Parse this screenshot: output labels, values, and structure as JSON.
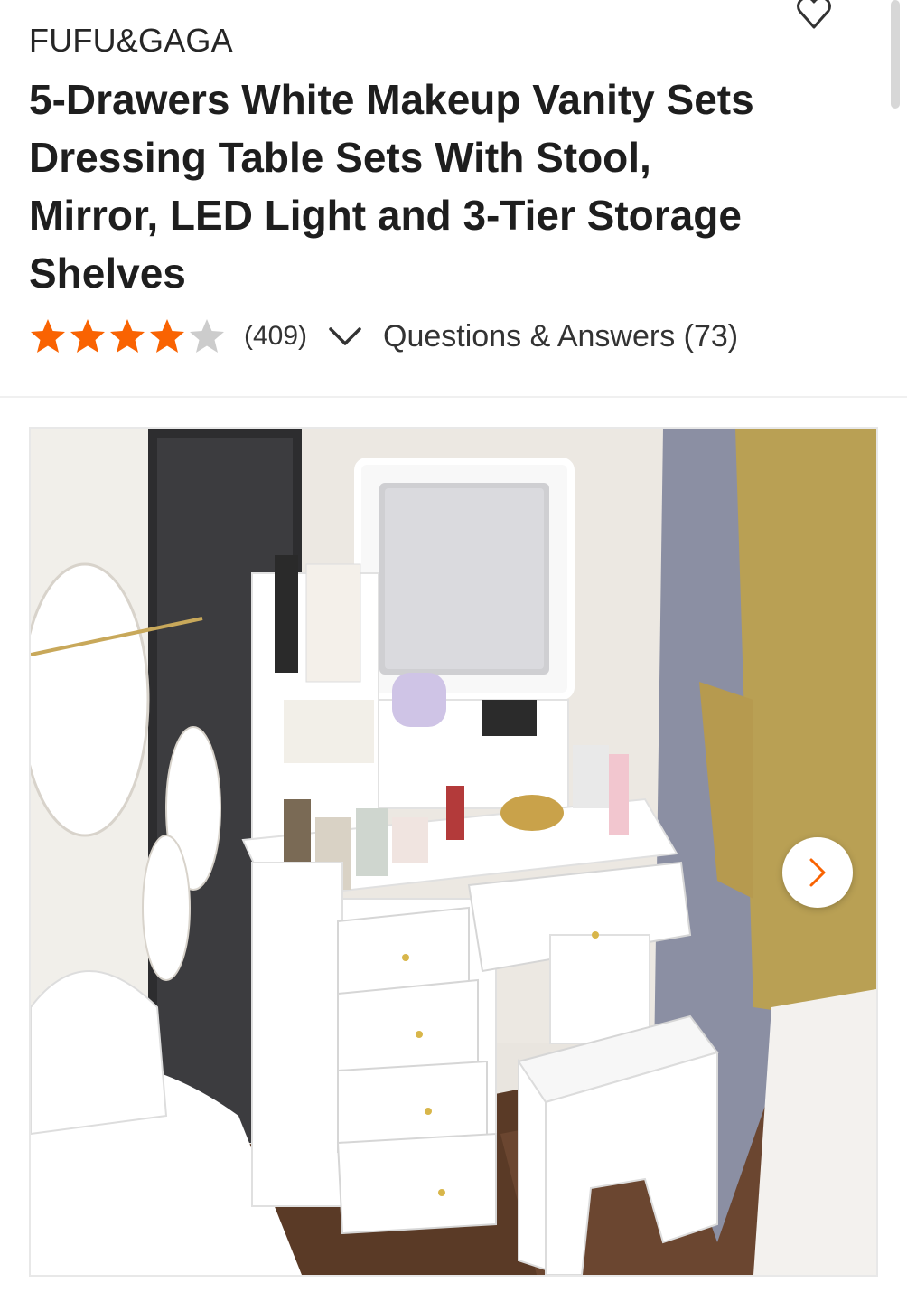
{
  "product": {
    "brand": "FUFU&GAGA",
    "title": "5-Drawers White Makeup Vanity Sets Dressing Table Sets With Stool, Mirror, LED Light and 3-Tier Storage Shelves",
    "rating": {
      "stars": 4,
      "max_stars": 5,
      "review_count": "(409)"
    },
    "qa_link": "Questions & Answers (73)"
  },
  "gallery": {
    "next_icon": "chevron-right-icon",
    "image_subject": "white makeup vanity with lit mirror, drawers and stool"
  },
  "icons": {
    "wishlist": "heart-outline-icon",
    "expand": "chevron-down-icon",
    "star": "star-icon"
  },
  "colors": {
    "star_filled": "#f96302",
    "star_empty": "#cccccc",
    "accent": "#f96302",
    "text": "#1e1e1e"
  }
}
